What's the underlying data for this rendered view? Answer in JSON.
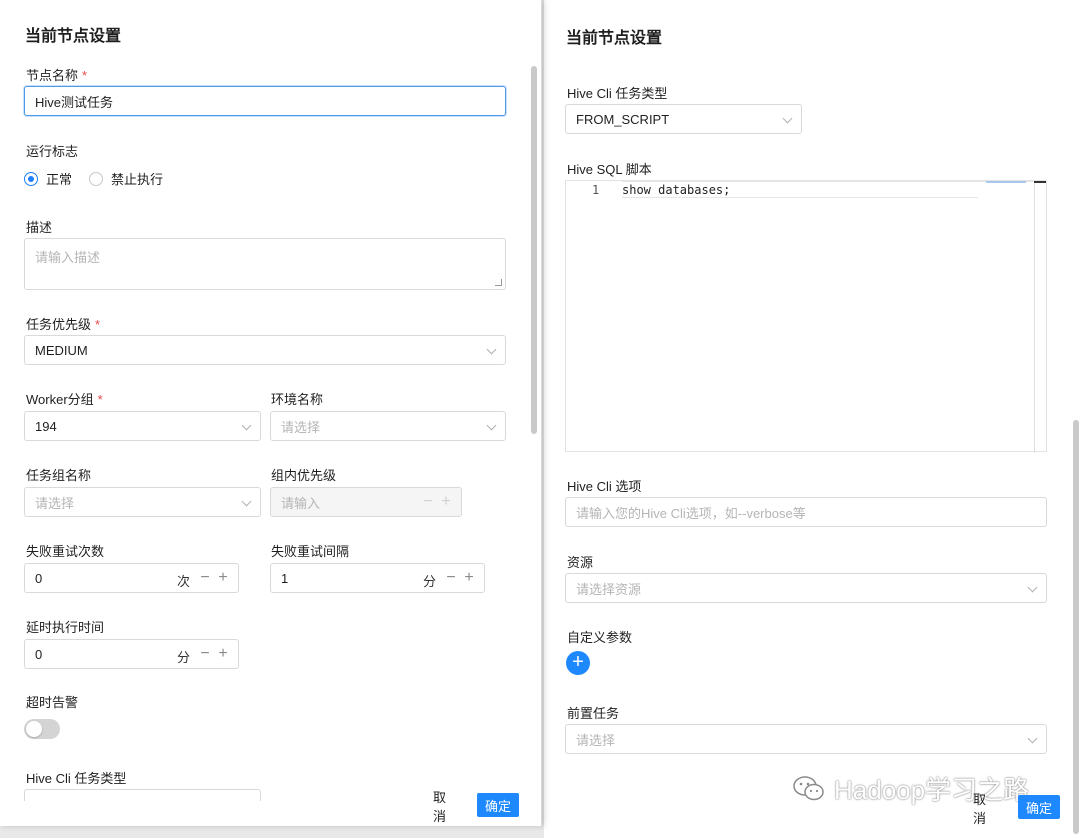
{
  "left": {
    "title": "当前节点设置",
    "node_name": {
      "label": "节点名称",
      "required": "*",
      "value": "Hive测试任务"
    },
    "run_flag": {
      "label": "运行标志",
      "options": [
        "正常",
        "禁止执行"
      ],
      "selected": "正常"
    },
    "description": {
      "label": "描述",
      "placeholder": "请输入描述"
    },
    "priority": {
      "label": "任务优先级",
      "required": "*",
      "value": "MEDIUM"
    },
    "worker_group": {
      "label": "Worker分组",
      "required": "*",
      "value": "194"
    },
    "environment": {
      "label": "环境名称",
      "placeholder": "请选择"
    },
    "task_group": {
      "label": "任务组名称",
      "placeholder": "请选择"
    },
    "group_priority": {
      "label": "组内优先级",
      "placeholder": "请输入"
    },
    "retry_times": {
      "label": "失败重试次数",
      "value": "0",
      "unit": "次"
    },
    "retry_interval": {
      "label": "失败重试间隔",
      "value": "1",
      "unit": "分"
    },
    "delay_time": {
      "label": "延时执行时间",
      "value": "0",
      "unit": "分"
    },
    "timeout_alarm": {
      "label": "超时告警",
      "enabled": false
    },
    "hive_cli_type": {
      "label": "Hive Cli 任务类型"
    },
    "cancel": "取消",
    "confirm": "确定",
    "stepper": {
      "minus": "−",
      "plus": "+"
    }
  },
  "right": {
    "title": "当前节点设置",
    "hive_cli_type": {
      "label": "Hive Cli 任务类型",
      "value": "FROM_SCRIPT"
    },
    "hive_sql": {
      "label": "Hive SQL 脚本",
      "lines": [
        {
          "no": "1",
          "code": "show databases;"
        }
      ]
    },
    "hive_cli_options": {
      "label": "Hive Cli 选项",
      "placeholder": "请输入您的Hive Cli选项，如--verbose等"
    },
    "resources": {
      "label": "资源",
      "placeholder": "请选择资源"
    },
    "custom_params": {
      "label": "自定义参数",
      "add": "+"
    },
    "pre_tasks": {
      "label": "前置任务",
      "placeholder": "请选择"
    },
    "cancel": "取消",
    "confirm": "确定"
  },
  "watermark": {
    "text": "Hadoop学习之路"
  },
  "colors": {
    "primary": "#1e88ff",
    "required": "#e5484d",
    "focus_border": "#4e9be8"
  }
}
